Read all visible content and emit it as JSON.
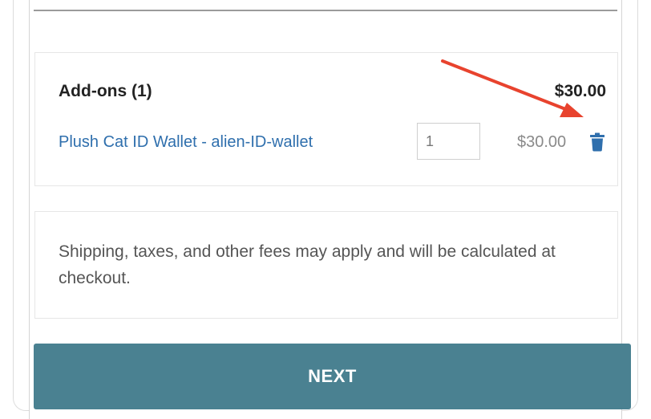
{
  "addons": {
    "title": "Add-ons (1)",
    "total": "$30.00",
    "item": {
      "name": "Plush Cat ID Wallet - alien-ID-wallet",
      "quantity": "1",
      "price": "$30.00",
      "remove_icon": "trash-icon"
    }
  },
  "notice": {
    "text": "Shipping, taxes, and other fees may apply and will be calculated at checkout."
  },
  "next_button": {
    "label": "NEXT"
  },
  "colors": {
    "link": "#2f6fad",
    "button": "#4a8191",
    "trash_icon": "#2f6fad",
    "annotation_arrow": "#e8432e"
  }
}
